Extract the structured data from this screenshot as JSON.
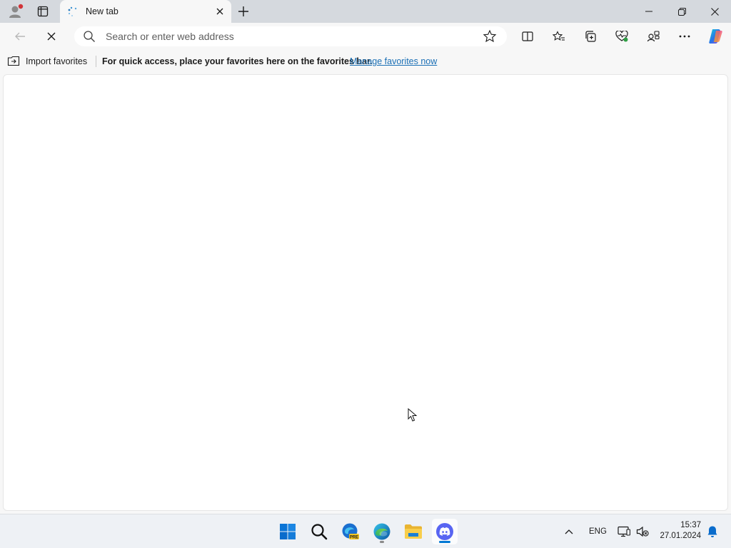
{
  "browser": {
    "tab": {
      "title": "New tab"
    },
    "address_bar": {
      "placeholder": "Search or enter web address",
      "value": ""
    },
    "favorites_bar": {
      "import_label": "Import favorites",
      "hint": "For quick access, place your favorites here on the favorites bar.",
      "manage_link": "Manage favorites now"
    }
  },
  "icons": {
    "profile": "profile-avatar-icon",
    "workspaces": "tab-actions-icon",
    "tab_favicon": "loading-spinner-icon",
    "close": "close-icon",
    "new_tab": "plus-icon",
    "minimize": "minimize-icon",
    "restore": "restore-icon",
    "back": "back-arrow-icon",
    "stop": "stop-loading-icon",
    "search": "search-icon",
    "star": "star-icon",
    "split_screen": "split-screen-icon",
    "favorites": "favorites-icon",
    "collections": "collections-icon",
    "browser_essentials": "heart-pulse-icon",
    "extensions": "extensions-icon",
    "more": "more-icon",
    "copilot": "copilot-icon"
  },
  "taskbar": {
    "apps": [
      {
        "name": "Start",
        "icon": "windows-start-icon"
      },
      {
        "name": "Search",
        "icon": "search-icon"
      },
      {
        "name": "Edge Canary",
        "icon": "edge-pre-icon"
      },
      {
        "name": "Edge",
        "icon": "edge-icon"
      },
      {
        "name": "File Explorer",
        "icon": "folder-icon"
      },
      {
        "name": "Discord",
        "icon": "discord-icon"
      }
    ],
    "tray": {
      "language": "ENG",
      "time": "15:37",
      "date": "27.01.2024"
    }
  },
  "colors": {
    "accent": "#1a6fb5",
    "discord": "#5865f2",
    "notification_dot": "#d13438",
    "windows_blue": "#0078d4"
  }
}
